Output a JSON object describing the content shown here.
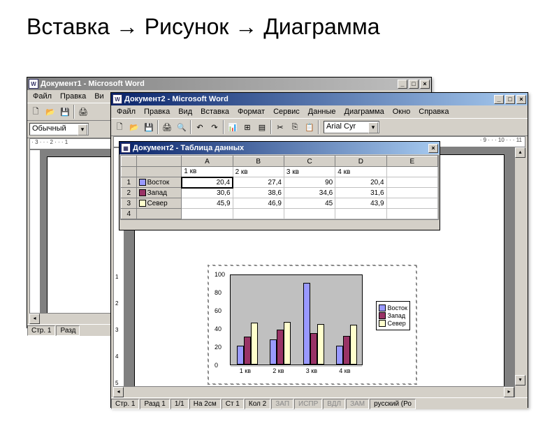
{
  "slide": {
    "title": "Вставка → Рисунок → Диаграмма"
  },
  "win1": {
    "title": "Документ1 - Microsoft Word",
    "menu": [
      "Файл",
      "Правка",
      "Ви"
    ],
    "style_combo": "Обычный",
    "status": {
      "page": "Стр. 1",
      "section": "Разд"
    }
  },
  "win2": {
    "title": "Документ2 - Microsoft Word",
    "menu": [
      "Файл",
      "Правка",
      "Вид",
      "Вставка",
      "Формат",
      "Сервис",
      "Данные",
      "Диаграмма",
      "Окно",
      "Справка"
    ],
    "font_combo": "Arial Cyr",
    "status": {
      "page": "Стр. 1",
      "section": "Разд 1",
      "pageno": "1/1",
      "at": "На 2см",
      "line": "Ст 1",
      "col": "Кол 2",
      "flags": [
        "ЗАП",
        "ИСПР",
        "ВДЛ",
        "ЗАМ"
      ],
      "lang": "русский (Ро"
    }
  },
  "datasheet": {
    "title": "Документ2 - Таблица данных",
    "col_heads": [
      "A",
      "B",
      "C",
      "D",
      "E"
    ],
    "col_labels": [
      "1 кв",
      "2 кв",
      "3 кв",
      "4 кв"
    ],
    "row_heads": [
      "1",
      "2",
      "3",
      "4"
    ],
    "rows": [
      {
        "name": "Восток",
        "vals": [
          "20,4",
          "27,4",
          "90",
          "20,4"
        ]
      },
      {
        "name": "Запад",
        "vals": [
          "30,6",
          "38,6",
          "34,6",
          "31,6"
        ]
      },
      {
        "name": "Север",
        "vals": [
          "45,9",
          "46,9",
          "45",
          "43,9"
        ]
      }
    ]
  },
  "chart_data": {
    "type": "bar",
    "categories": [
      "1 кв",
      "2 кв",
      "3 кв",
      "4 кв"
    ],
    "series": [
      {
        "name": "Восток",
        "color": "#9999ff",
        "values": [
          20.4,
          27.4,
          90,
          20.4
        ]
      },
      {
        "name": "Запад",
        "color": "#993366",
        "values": [
          30.6,
          38.6,
          34.6,
          31.6
        ]
      },
      {
        "name": "Север",
        "color": "#ffffcc",
        "values": [
          45.9,
          46.9,
          45,
          43.9
        ]
      }
    ],
    "ylim": [
      0,
      100
    ],
    "yticks": [
      0,
      20,
      40,
      60,
      80,
      100
    ],
    "legend_position": "right"
  }
}
